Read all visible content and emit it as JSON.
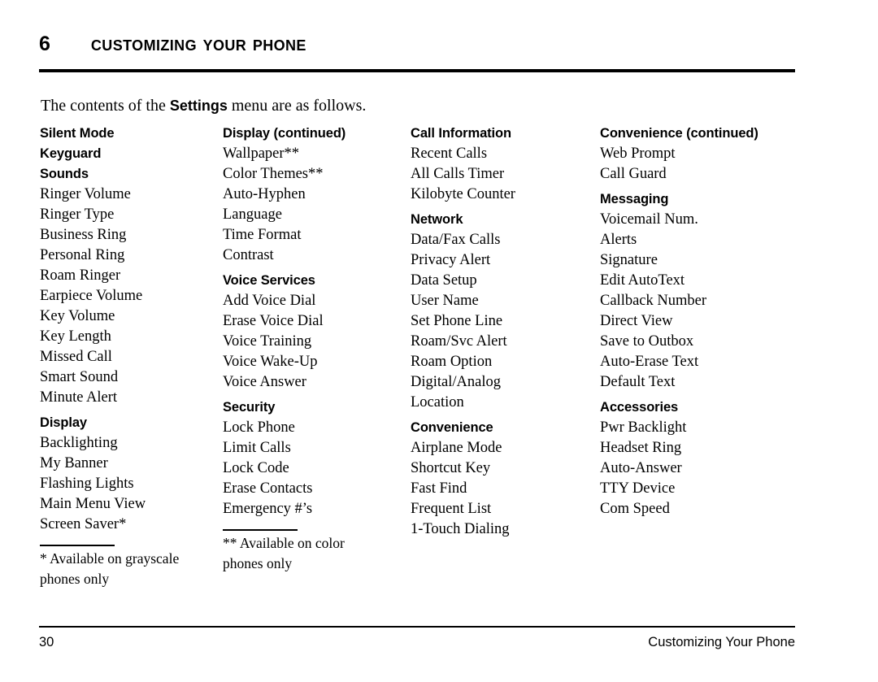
{
  "header": {
    "chapter_number": "6",
    "chapter_title": "Customizing Your Phone"
  },
  "intro": {
    "before": "The contents of the ",
    "emphasis": "Settings",
    "after": " menu are as follows."
  },
  "columns": [
    {
      "id": "column-1",
      "blocks": [
        {
          "type": "heading",
          "label": "Silent Mode",
          "spaced": false
        },
        {
          "type": "heading",
          "label": "Keyguard",
          "spaced": false
        },
        {
          "type": "heading",
          "label": "Sounds",
          "spaced": false
        },
        {
          "type": "entry",
          "label": "Ringer Volume"
        },
        {
          "type": "entry",
          "label": "Ringer Type"
        },
        {
          "type": "entry",
          "label": "Business Ring"
        },
        {
          "type": "entry",
          "label": "Personal Ring"
        },
        {
          "type": "entry",
          "label": "Roam Ringer"
        },
        {
          "type": "entry",
          "label": "Earpiece Volume"
        },
        {
          "type": "entry",
          "label": "Key Volume"
        },
        {
          "type": "entry",
          "label": "Key Length"
        },
        {
          "type": "entry",
          "label": "Missed Call"
        },
        {
          "type": "entry",
          "label": "Smart Sound"
        },
        {
          "type": "entry",
          "label": "Minute Alert"
        },
        {
          "type": "heading",
          "label": "Display",
          "spaced": true
        },
        {
          "type": "entry",
          "label": "Backlighting"
        },
        {
          "type": "entry",
          "label": "My Banner"
        },
        {
          "type": "entry",
          "label": "Flashing Lights"
        },
        {
          "type": "entry",
          "label": "Main Menu View"
        },
        {
          "type": "entry",
          "label": "Screen Saver*"
        }
      ],
      "footnote": "* Available on grayscale phones only"
    },
    {
      "id": "column-2",
      "blocks": [
        {
          "type": "heading",
          "label": "Display (continued)",
          "spaced": false
        },
        {
          "type": "entry",
          "label": "Wallpaper**"
        },
        {
          "type": "entry",
          "label": "Color Themes**"
        },
        {
          "type": "entry",
          "label": "Auto-Hyphen"
        },
        {
          "type": "entry",
          "label": "Language"
        },
        {
          "type": "entry",
          "label": "Time Format"
        },
        {
          "type": "entry",
          "label": "Contrast"
        },
        {
          "type": "heading",
          "label": "Voice Services",
          "spaced": true
        },
        {
          "type": "entry",
          "label": "Add Voice Dial"
        },
        {
          "type": "entry",
          "label": "Erase Voice Dial"
        },
        {
          "type": "entry",
          "label": "Voice Training"
        },
        {
          "type": "entry",
          "label": "Voice Wake-Up"
        },
        {
          "type": "entry",
          "label": "Voice Answer"
        },
        {
          "type": "heading",
          "label": "Security",
          "spaced": true
        },
        {
          "type": "entry",
          "label": "Lock Phone"
        },
        {
          "type": "entry",
          "label": "Limit Calls"
        },
        {
          "type": "entry",
          "label": "Lock Code"
        },
        {
          "type": "entry",
          "label": "Erase Contacts"
        },
        {
          "type": "entry",
          "label": "Emergency #’s"
        }
      ],
      "footnote": "** Available on color phones only"
    },
    {
      "id": "column-3",
      "blocks": [
        {
          "type": "heading",
          "label": "Call Information",
          "spaced": false
        },
        {
          "type": "entry",
          "label": "Recent Calls"
        },
        {
          "type": "entry",
          "label": "All Calls Timer"
        },
        {
          "type": "entry",
          "label": "Kilobyte Counter"
        },
        {
          "type": "heading",
          "label": "Network",
          "spaced": true
        },
        {
          "type": "entry",
          "label": "Data/Fax Calls"
        },
        {
          "type": "entry",
          "label": "Privacy Alert"
        },
        {
          "type": "entry",
          "label": "Data Setup"
        },
        {
          "type": "entry",
          "label": "User Name"
        },
        {
          "type": "entry",
          "label": "Set Phone Line"
        },
        {
          "type": "entry",
          "label": "Roam/Svc Alert"
        },
        {
          "type": "entry",
          "label": "Roam Option"
        },
        {
          "type": "entry",
          "label": "Digital/Analog"
        },
        {
          "type": "entry",
          "label": "Location"
        },
        {
          "type": "heading",
          "label": "Convenience",
          "spaced": true
        },
        {
          "type": "entry",
          "label": "Airplane Mode"
        },
        {
          "type": "entry",
          "label": "Shortcut Key"
        },
        {
          "type": "entry",
          "label": "Fast Find"
        },
        {
          "type": "entry",
          "label": "Frequent List"
        },
        {
          "type": "entry",
          "label": "1-Touch Dialing"
        }
      ],
      "footnote": null
    },
    {
      "id": "column-4",
      "blocks": [
        {
          "type": "heading",
          "label": "Convenience (continued)",
          "spaced": false
        },
        {
          "type": "entry",
          "label": "Web Prompt"
        },
        {
          "type": "entry",
          "label": "Call Guard"
        },
        {
          "type": "heading",
          "label": "Messaging",
          "spaced": true
        },
        {
          "type": "entry",
          "label": "Voicemail Num."
        },
        {
          "type": "entry",
          "label": "Alerts"
        },
        {
          "type": "entry",
          "label": "Signature"
        },
        {
          "type": "entry",
          "label": "Edit AutoText"
        },
        {
          "type": "entry",
          "label": "Callback Number"
        },
        {
          "type": "entry",
          "label": "Direct View"
        },
        {
          "type": "entry",
          "label": "Save to Outbox"
        },
        {
          "type": "entry",
          "label": "Auto-Erase Text"
        },
        {
          "type": "entry",
          "label": "Default Text"
        },
        {
          "type": "heading",
          "label": "Accessories",
          "spaced": true
        },
        {
          "type": "entry",
          "label": "Pwr Backlight"
        },
        {
          "type": "entry",
          "label": "Headset Ring"
        },
        {
          "type": "entry",
          "label": "Auto-Answer"
        },
        {
          "type": "entry",
          "label": "TTY Device"
        },
        {
          "type": "entry",
          "label": "Com Speed"
        }
      ],
      "footnote": null
    }
  ],
  "footer": {
    "page_number": "30",
    "running_title": "Customizing Your Phone"
  }
}
